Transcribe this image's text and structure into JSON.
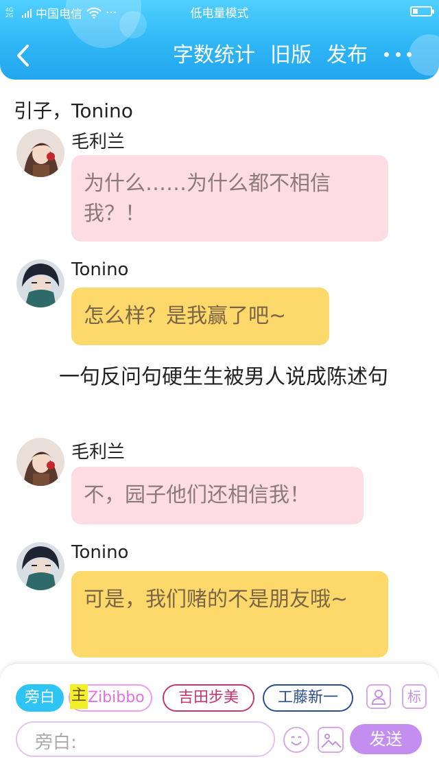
{
  "status_bar": {
    "network_tag": "4G 2G",
    "carrier": "中国电信",
    "more": "···",
    "mode": "低电量模式",
    "battery_level": 0.3
  },
  "nav": {
    "back": "<",
    "actions": [
      "字数统计",
      "旧版",
      "发布"
    ]
  },
  "story": {
    "title_line": "引子，Tonino",
    "items": [
      {
        "speaker": "毛利兰",
        "text": "为什么……为什么都不相信我？！",
        "style": "pink"
      },
      {
        "speaker": "Tonino",
        "text": "怎么样？是我赢了吧~",
        "style": "yellow"
      },
      {
        "narration": "一句反问句硬生生被男人说成陈述句"
      },
      {
        "speaker": "毛利兰",
        "text": "不，园子他们还相信我！",
        "style": "pink"
      },
      {
        "speaker": "Tonino",
        "text": "可是，我们赌的不是朋友哦~",
        "style": "yellow"
      }
    ]
  },
  "composer": {
    "chips": {
      "narration": "旁白",
      "main_tag": "主",
      "main_name": "Zibibbo",
      "ayumi": "吉田步美",
      "shinichi": "工藤新一"
    },
    "tag_button": "标",
    "input_label": "旁白:",
    "input_value": "",
    "send": "发送"
  },
  "colors": {
    "header": "#2fb6f5",
    "pink_bubble": "#fddde3",
    "yellow_bubble": "#fdd86a",
    "send_button": "#c48ef0"
  }
}
